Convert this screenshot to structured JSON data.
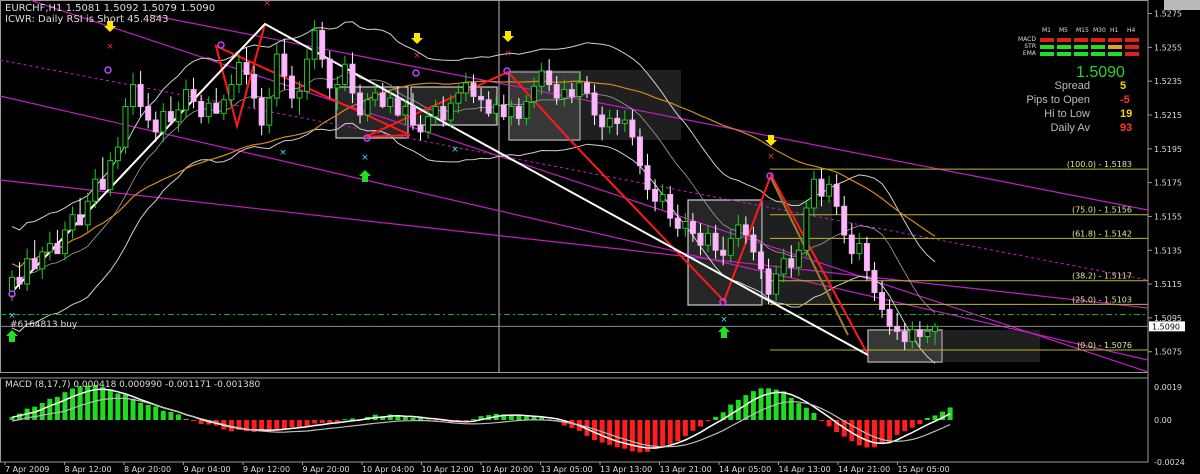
{
  "symbol_line": "EURCHF,H1  1.5081 1.5092 1.5079 1.5090",
  "indicator_line": "ICWR: Daily RSI is Short 45.4843",
  "order_label": "#6164813 buy",
  "current_price_tag": "1.5090",
  "macd_label": "MACD (8,17,7) 0.000418 0.000990 -0.001171 -0.001380",
  "signal_panel": {
    "timeframes": [
      "M1",
      "M5",
      "M15",
      "M30",
      "H1",
      "H4"
    ],
    "rows": [
      {
        "name": "MACD",
        "colors": [
          "#e02020",
          "#e02020",
          "#e02020",
          "#e02020",
          "#e02020",
          "#e02020"
        ]
      },
      {
        "name": "STR",
        "colors": [
          "#20e020",
          "#20e020",
          "#20e020",
          "#20e020",
          "#e0a020",
          "#e02020"
        ]
      },
      {
        "name": "EMA",
        "colors": [
          "#20e020",
          "#20e020",
          "#20e020",
          "#20e020",
          "#20e020",
          "#e02020"
        ]
      }
    ],
    "price": "1.5090",
    "stats": [
      {
        "label": "Spread",
        "value": "5",
        "color": "#f5d60a"
      },
      {
        "label": "Pips to Open",
        "value": "-5",
        "color": "#ff3b1f"
      },
      {
        "label": "Hi to Low",
        "value": "19",
        "color": "#f5d60a"
      },
      {
        "label": "Daily Av",
        "value": "93",
        "color": "#ff3b1f"
      }
    ]
  },
  "chart_data": {
    "type": "candlestick",
    "symbol": "EURCHF",
    "timeframe": "H1",
    "ylim": [
      1.5063,
      1.5283
    ],
    "price_ticks": [
      "1.5275",
      "1.5255",
      "1.5235",
      "1.5215",
      "1.5195",
      "1.5175",
      "1.5155",
      "1.5135",
      "1.5115",
      "1.5095",
      "1.5075"
    ],
    "price_tick_values": [
      1.5275,
      1.5255,
      1.5235,
      1.5215,
      1.5195,
      1.5175,
      1.5155,
      1.5135,
      1.5115,
      1.5095,
      1.5075
    ],
    "time_labels": [
      "7 Apr 2009",
      "8 Apr 12:00",
      "8 Apr 20:00",
      "9 Apr 04:00",
      "9 Apr 12:00",
      "9 Apr 20:00",
      "10 Apr 04:00",
      "10 Apr 12:00",
      "10 Apr 20:00",
      "13 Apr 05:00",
      "13 Apr 13:00",
      "13 Apr 21:00",
      "14 Apr 05:00",
      "14 Apr 13:00",
      "14 Apr 21:00",
      "15 Apr 05:00"
    ],
    "fib_levels": [
      {
        "label": "(100.0) - 1.5183",
        "price": 1.5183
      },
      {
        "label": "(75.0) - 1.5156",
        "price": 1.5156
      },
      {
        "label": "(61.8) - 1.5142",
        "price": 1.5142
      },
      {
        "label": "(38.2) - 1.5117",
        "price": 1.5117
      },
      {
        "label": "(25.0) - 1.5103",
        "price": 1.5103
      },
      {
        "label": "(0.0) - 1.5076",
        "price": 1.5076
      }
    ],
    "bid_price": 1.509,
    "order_price": 1.5097,
    "macd": {
      "ylim": [
        -0.0024,
        0.0024
      ],
      "ticks": [
        "0.0019",
        "0.00",
        "-0.0024"
      ],
      "tick_values": [
        0.0019,
        0.0,
        -0.0024
      ]
    },
    "candles": [
      [
        1.5108,
        1.5123,
        1.5105,
        1.5119
      ],
      [
        1.5119,
        1.5128,
        1.5112,
        1.5115
      ],
      [
        1.5115,
        1.5136,
        1.5111,
        1.513
      ],
      [
        1.513,
        1.5141,
        1.5125,
        1.5124
      ],
      [
        1.5124,
        1.5137,
        1.5118,
        1.5134
      ],
      [
        1.5134,
        1.5146,
        1.5129,
        1.5139
      ],
      [
        1.5139,
        1.5147,
        1.5133,
        1.5133
      ],
      [
        1.5133,
        1.5152,
        1.5129,
        1.5147
      ],
      [
        1.5147,
        1.5161,
        1.5142,
        1.5156
      ],
      [
        1.5156,
        1.5166,
        1.5151,
        1.515
      ],
      [
        1.515,
        1.5169,
        1.5146,
        1.5164
      ],
      [
        1.5164,
        1.5183,
        1.516,
        1.5177
      ],
      [
        1.5177,
        1.519,
        1.5172,
        1.5171
      ],
      [
        1.5171,
        1.5193,
        1.5167,
        1.5188
      ],
      [
        1.5188,
        1.5202,
        1.5183,
        1.5196
      ],
      [
        1.5196,
        1.5225,
        1.5192,
        1.522
      ],
      [
        1.522,
        1.524,
        1.5215,
        1.5233
      ],
      [
        1.5233,
        1.5241,
        1.5214,
        1.522
      ],
      [
        1.522,
        1.5228,
        1.5207,
        1.5212
      ],
      [
        1.5212,
        1.5217,
        1.5199,
        1.5205
      ],
      [
        1.5205,
        1.5222,
        1.5199,
        1.5217
      ],
      [
        1.5217,
        1.5226,
        1.5209,
        1.5211
      ],
      [
        1.5211,
        1.5223,
        1.5205,
        1.5218
      ],
      [
        1.5218,
        1.5236,
        1.5213,
        1.523
      ],
      [
        1.523,
        1.5237,
        1.5219,
        1.5223
      ],
      [
        1.5223,
        1.5227,
        1.521,
        1.5214
      ],
      [
        1.5214,
        1.5226,
        1.521,
        1.5222
      ],
      [
        1.5222,
        1.5231,
        1.5216,
        1.5216
      ],
      [
        1.5216,
        1.5227,
        1.5212,
        1.5224
      ],
      [
        1.5224,
        1.5239,
        1.522,
        1.5233
      ],
      [
        1.5233,
        1.5251,
        1.5228,
        1.5246
      ],
      [
        1.5246,
        1.5255,
        1.5233,
        1.5239
      ],
      [
        1.5239,
        1.5244,
        1.5219,
        1.5225
      ],
      [
        1.5225,
        1.5231,
        1.5203,
        1.5209
      ],
      [
        1.5209,
        1.5231,
        1.5204,
        1.5225
      ],
      [
        1.5225,
        1.5258,
        1.522,
        1.5251
      ],
      [
        1.5251,
        1.526,
        1.523,
        1.5238
      ],
      [
        1.5238,
        1.5244,
        1.5219,
        1.5225
      ],
      [
        1.5225,
        1.5235,
        1.5215,
        1.5229
      ],
      [
        1.5229,
        1.5254,
        1.5224,
        1.5248
      ],
      [
        1.5248,
        1.5271,
        1.5242,
        1.5265
      ],
      [
        1.5265,
        1.527,
        1.5243,
        1.5248
      ],
      [
        1.5248,
        1.5253,
        1.5225,
        1.5231
      ],
      [
        1.5231,
        1.5238,
        1.5218,
        1.5233
      ],
      [
        1.5233,
        1.525,
        1.5229,
        1.5245
      ],
      [
        1.5245,
        1.5252,
        1.5222,
        1.5228
      ],
      [
        1.5228,
        1.5233,
        1.521,
        1.5215
      ],
      [
        1.5215,
        1.5228,
        1.5211,
        1.5224
      ],
      [
        1.5224,
        1.5234,
        1.522,
        1.5228
      ],
      [
        1.5228,
        1.5234,
        1.5219,
        1.522
      ],
      [
        1.522,
        1.523,
        1.5216,
        1.5225
      ],
      [
        1.5225,
        1.5232,
        1.5214,
        1.5215
      ],
      [
        1.5215,
        1.5224,
        1.5209,
        1.522
      ],
      [
        1.522,
        1.5228,
        1.5206,
        1.5209
      ],
      [
        1.5209,
        1.5215,
        1.52,
        1.5205
      ],
      [
        1.5205,
        1.5218,
        1.5201,
        1.5214
      ],
      [
        1.5214,
        1.5224,
        1.5209,
        1.522
      ],
      [
        1.522,
        1.5226,
        1.5208,
        1.5212
      ],
      [
        1.5212,
        1.5227,
        1.5208,
        1.5222
      ],
      [
        1.5222,
        1.5233,
        1.5216,
        1.5228
      ],
      [
        1.5228,
        1.524,
        1.5223,
        1.5234
      ],
      [
        1.5234,
        1.5239,
        1.5222,
        1.5226
      ],
      [
        1.5226,
        1.5231,
        1.5217,
        1.5224
      ],
      [
        1.5224,
        1.5229,
        1.5214,
        1.5216
      ],
      [
        1.5216,
        1.5226,
        1.5211,
        1.5221
      ],
      [
        1.5221,
        1.5227,
        1.5212,
        1.5214
      ],
      [
        1.5214,
        1.5224,
        1.5209,
        1.522
      ],
      [
        1.522,
        1.5225,
        1.5209,
        1.5213
      ],
      [
        1.5213,
        1.5227,
        1.5209,
        1.5223
      ],
      [
        1.5223,
        1.5237,
        1.5219,
        1.5232
      ],
      [
        1.5232,
        1.5246,
        1.5227,
        1.5241
      ],
      [
        1.5241,
        1.5248,
        1.5229,
        1.5233
      ],
      [
        1.5233,
        1.5238,
        1.5221,
        1.5225
      ],
      [
        1.5225,
        1.5236,
        1.522,
        1.523
      ],
      [
        1.523,
        1.5234,
        1.5222,
        1.5226
      ],
      [
        1.5226,
        1.524,
        1.5222,
        1.5234
      ],
      [
        1.5234,
        1.5238,
        1.5225,
        1.5228
      ],
      [
        1.5228,
        1.5233,
        1.5209,
        1.5215
      ],
      [
        1.5215,
        1.522,
        1.52,
        1.5208
      ],
      [
        1.5208,
        1.5218,
        1.5204,
        1.5213
      ],
      [
        1.5213,
        1.5218,
        1.5203,
        1.521
      ],
      [
        1.521,
        1.5218,
        1.5205,
        1.5212
      ],
      [
        1.5212,
        1.5218,
        1.5197,
        1.5202
      ],
      [
        1.5202,
        1.5207,
        1.518,
        1.5185
      ],
      [
        1.5185,
        1.5192,
        1.5165,
        1.5171
      ],
      [
        1.5171,
        1.5177,
        1.5158,
        1.5164
      ],
      [
        1.5164,
        1.5174,
        1.5159,
        1.5168
      ],
      [
        1.5168,
        1.5173,
        1.5149,
        1.5154
      ],
      [
        1.5154,
        1.5162,
        1.5143,
        1.5148
      ],
      [
        1.5148,
        1.5157,
        1.5143,
        1.5152
      ],
      [
        1.5152,
        1.5157,
        1.514,
        1.5145
      ],
      [
        1.5145,
        1.5151,
        1.5132,
        1.5138
      ],
      [
        1.5138,
        1.515,
        1.5134,
        1.5145
      ],
      [
        1.5145,
        1.515,
        1.513,
        1.5135
      ],
      [
        1.5135,
        1.5143,
        1.5126,
        1.5132
      ],
      [
        1.5132,
        1.5147,
        1.5128,
        1.5142
      ],
      [
        1.5142,
        1.5156,
        1.5137,
        1.515
      ],
      [
        1.515,
        1.5155,
        1.5139,
        1.5144
      ],
      [
        1.5144,
        1.5149,
        1.5129,
        1.5134
      ],
      [
        1.5134,
        1.5139,
        1.5118,
        1.5124
      ],
      [
        1.5124,
        1.513,
        1.5103,
        1.5109
      ],
      [
        1.5109,
        1.5126,
        1.5105,
        1.5121
      ],
      [
        1.5121,
        1.5136,
        1.5116,
        1.513
      ],
      [
        1.513,
        1.5138,
        1.5119,
        1.5125
      ],
      [
        1.5125,
        1.514,
        1.512,
        1.5135
      ],
      [
        1.5135,
        1.5165,
        1.5131,
        1.516
      ],
      [
        1.516,
        1.5182,
        1.5155,
        1.5177
      ],
      [
        1.5177,
        1.5183,
        1.5161,
        1.5167
      ],
      [
        1.5167,
        1.5179,
        1.5163,
        1.5174
      ],
      [
        1.5174,
        1.518,
        1.5156,
        1.5161
      ],
      [
        1.5161,
        1.5167,
        1.5139,
        1.5144
      ],
      [
        1.5144,
        1.5151,
        1.5127,
        1.5133
      ],
      [
        1.5133,
        1.5145,
        1.5129,
        1.5139
      ],
      [
        1.5139,
        1.5143,
        1.5117,
        1.5123
      ],
      [
        1.5123,
        1.5128,
        1.5105,
        1.511
      ],
      [
        1.511,
        1.5117,
        1.5095,
        1.51
      ],
      [
        1.51,
        1.5106,
        1.5085,
        1.509
      ],
      [
        1.509,
        1.5098,
        1.5082,
        1.5087
      ],
      [
        1.5087,
        1.5092,
        1.5076,
        1.5081
      ],
      [
        1.5081,
        1.5093,
        1.5077,
        1.5088
      ],
      [
        1.5088,
        1.5093,
        1.5078,
        1.5084
      ],
      [
        1.5084,
        1.5091,
        1.508,
        1.5087
      ],
      [
        1.5087,
        1.5092,
        1.5079,
        1.509
      ]
    ],
    "macd_hist": [
      0.00018,
      0.00037,
      0.00065,
      0.00076,
      0.00097,
      0.00121,
      0.00132,
      0.00159,
      0.0018,
      0.00193,
      0.00197,
      0.00201,
      0.00188,
      0.00175,
      0.00152,
      0.00147,
      0.00121,
      0.00098,
      0.00086,
      0.00077,
      0.00053,
      0.00046,
      0.00032,
      6e-05,
      -1e-05,
      -0.00023,
      -0.00026,
      -0.00032,
      -0.00054,
      -0.00065,
      -0.00057,
      -0.00064,
      -0.00069,
      -0.00063,
      -0.00066,
      -0.00057,
      -0.00051,
      -0.0004,
      -0.00044,
      -0.00036,
      -0.0002,
      -0.00017,
      -0.00016,
      -0.00018,
      5e-05,
      9e-05,
      4e-05,
      0.00017,
      0.0003,
      0.00022,
      0.00031,
      0.00027,
      0.00017,
      0.00013,
      0.00013,
      2e-05,
      -1e-05,
      -6e-05,
      -0.00016,
      -0.00012,
      -8e-05,
      5e-05,
      0.00022,
      0.00028,
      0.00035,
      0.00032,
      0.00029,
      0.00029,
      0.00022,
      0.00017,
      0.00014,
      3e-05,
      -4e-05,
      -0.00032,
      -0.00045,
      -0.00062,
      -0.00091,
      -0.00114,
      -0.00129,
      -0.00142,
      -0.00156,
      -0.00164,
      -0.00179,
      -0.00185,
      -0.00182,
      -0.00166,
      -0.00156,
      -0.00139,
      -0.00121,
      -0.00092,
      -0.00062,
      -0.00037,
      -4e-05,
      0.00018,
      0.00044,
      0.00088,
      0.00115,
      0.00142,
      0.00165,
      0.00181,
      0.00181,
      0.00174,
      0.00163,
      0.00127,
      0.00096,
      0.0007,
      0.0004,
      -1e-05,
      -0.00036,
      -0.00069,
      -0.00095,
      -0.00121,
      -0.00145,
      -0.00157,
      -0.00156,
      -0.00137,
      -0.00124,
      -0.00085,
      -0.00064,
      -0.00044,
      -0.00024,
      0.00012,
      0.00026,
      0.00048,
      0.00072
    ]
  }
}
